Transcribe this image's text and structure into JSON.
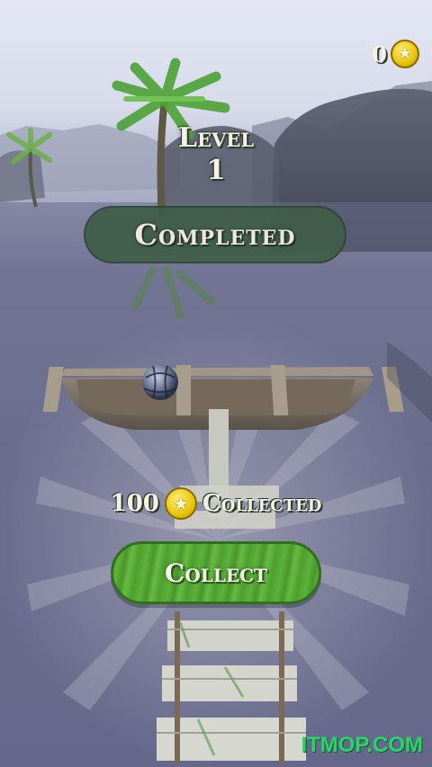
{
  "hud": {
    "coin_count": "0",
    "coin_icon": "star-coin-icon"
  },
  "level": {
    "label": "Level",
    "number": "1",
    "status": "Completed"
  },
  "reward": {
    "amount": "100",
    "label": "Collected",
    "coin_icon": "star-coin-icon"
  },
  "actions": {
    "collect_label": "Collect"
  },
  "watermark": "ITMOP.COM",
  "colors": {
    "banner": "#3f5d47",
    "collect_button": "#5cb23a",
    "coin": "#e8c40a",
    "watermark": "#2bd46a"
  }
}
